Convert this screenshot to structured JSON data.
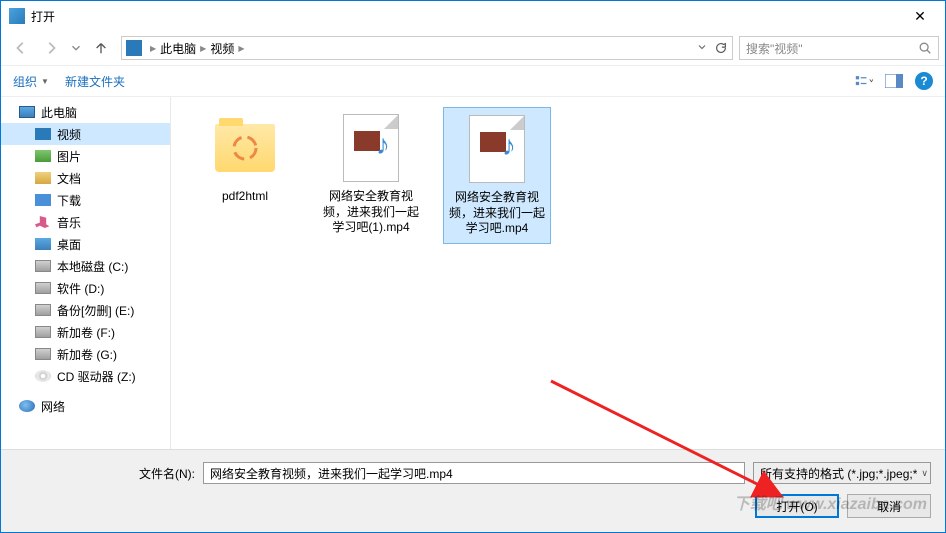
{
  "window": {
    "title": "打开",
    "close": "✕"
  },
  "breadcrumb": {
    "item1": "此电脑",
    "item2": "视频",
    "refresh": "↻"
  },
  "search": {
    "placeholder": "搜索\"视频\""
  },
  "toolbar": {
    "organize": "组织",
    "newFolder": "新建文件夹"
  },
  "sidebar": {
    "thispc": "此电脑",
    "video": "视频",
    "pictures": "图片",
    "documents": "文档",
    "downloads": "下载",
    "music": "音乐",
    "desktop": "桌面",
    "driveC": "本地磁盘 (C:)",
    "driveD": "软件 (D:)",
    "driveE": "备份[勿删] (E:)",
    "driveF": "新加卷 (F:)",
    "driveG": "新加卷 (G:)",
    "driveZ": "CD 驱动器 (Z:)",
    "network": "网络"
  },
  "files": {
    "f1": "pdf2html",
    "f2": "网络安全教育视频，进来我们一起学习吧(1).mp4",
    "f3": "网络安全教育视频，进来我们一起学习吧.mp4"
  },
  "bottom": {
    "fileNameLabel": "文件名(N):",
    "fileNameValue": "网络安全教育视频，进来我们一起学习吧.mp4",
    "fileTypeValue": "所有支持的格式 (*.jpg;*.jpeg;*",
    "open": "打开(O)",
    "cancel": "取消"
  },
  "watermark": "下载吧 www.xiazaiba.com"
}
